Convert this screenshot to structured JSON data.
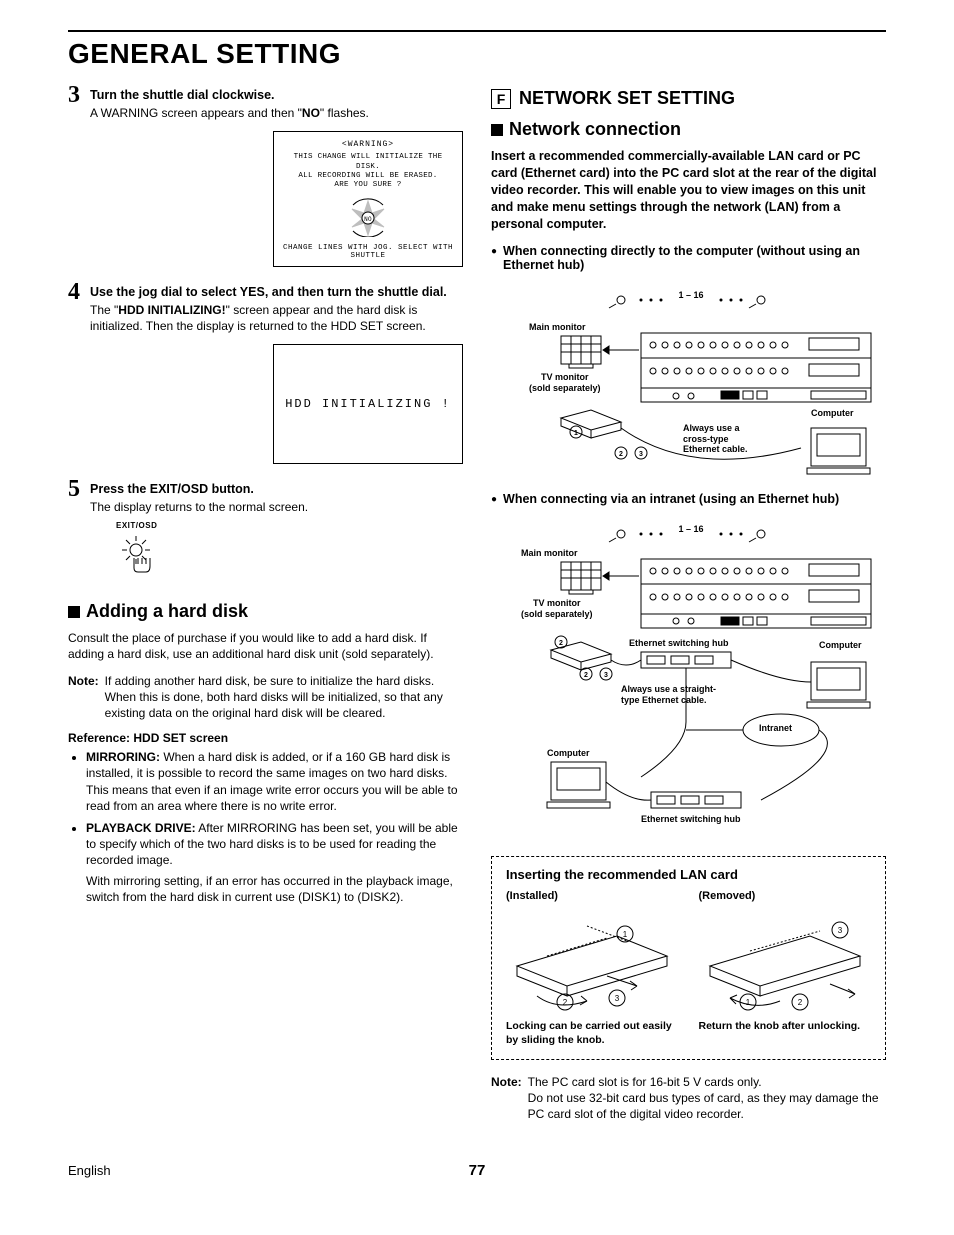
{
  "page_title": "GENERAL SETTING",
  "steps": {
    "s3": {
      "num": "3",
      "head": "Turn the shuttle dial clockwise.",
      "body_prefix": "A WARNING screen appears and then \"",
      "body_bold": "NO",
      "body_suffix": "\" flashes."
    },
    "warning_box": {
      "title": "<WARNING>",
      "line1": "THIS CHANGE WILL INITIALIZE THE DISK.",
      "line2": "ALL RECORDING WILL BE ERASED.",
      "line3": "ARE YOU SURE ?",
      "center": "NO",
      "footer": "CHANGE LINES WITH JOG. SELECT WITH SHUTTLE"
    },
    "s4": {
      "num": "4",
      "head": "Use the jog dial to select YES, and then turn the shuttle dial.",
      "body_prefix": "The \"",
      "body_bold": "HDD INITIALIZING!",
      "body_suffix": "\" screen appear and the hard disk is initialized. Then the display is returned to the HDD SET screen."
    },
    "init_box": "HDD INITIALIZING !",
    "s5": {
      "num": "5",
      "head": "Press the EXIT/OSD button.",
      "body": "The display returns to the normal screen.",
      "icon_label": "EXIT/OSD"
    }
  },
  "adding": {
    "title": "Adding a hard disk",
    "intro": "Consult the place of purchase if you would like to add a hard disk. If adding a hard disk, use an additional hard disk unit (sold separately).",
    "note_label": "Note:",
    "note_body": "If adding another hard disk, be sure to initialize the hard disks. When this is done, both hard disks will be initialized, so that any existing data on the original hard disk will be cleared.",
    "ref_title": "Reference: HDD SET screen",
    "mirroring_label": "MIRRORING:",
    "mirroring_body": "When a hard disk is added, or if a 160 GB hard disk is installed, it is possible to record the same images on two hard disks. This means that even if an image write error occurs you will be able to read from an area where there is no write error.",
    "playback_label": "PLAYBACK DRIVE:",
    "playback_body": "After MIRRORING has been set, you will be able to specify which of the two hard disks is to be used for reading the recorded image.",
    "playback_extra": "With mirroring setting, if an error has occurred in the playback image, switch from the hard disk in current use (DISK1) to (DISK2)."
  },
  "network": {
    "box_letter": "F",
    "section_title": "NETWORK SET SETTING",
    "sub_title": "Network connection",
    "intro": "Insert a recommended commercially-available LAN card or PC card (Ethernet card) into the PC card slot at the rear of the digital video recorder. This will enable you to view images on this unit and make menu settings through the network (LAN) from a personal computer.",
    "bullet1": "When connecting directly to the computer (without using an Ethernet hub)",
    "bullet2": "When connecting via an intranet (using an Ethernet hub)",
    "diag1": {
      "range": "1 – 16",
      "main_mon": "Main monitor",
      "tv_mon": "TV monitor\n(sold separately)",
      "computer": "Computer",
      "cable_note": "Always use a\ncross-type\nEthernet cable."
    },
    "diag2": {
      "range": "1 – 16",
      "main_mon": "Main monitor",
      "tv_mon": "TV monitor\n(sold separately)",
      "computer": "Computer",
      "computer2": "Computer",
      "hub1": "Ethernet switching hub",
      "hub2": "Ethernet switching hub",
      "cable_note": "Always use a straight-\ntype Ethernet cable.",
      "intranet": "Intranet"
    },
    "lan_box": {
      "title": "Inserting the recommended LAN card",
      "installed": "(Installed)",
      "removed": "(Removed)",
      "cap1": "Locking can be carried out easily by sliding the knob.",
      "cap2": "Return the knob after unlocking."
    },
    "note_label": "Note:",
    "note_body": "The PC card slot is for 16-bit 5 V cards only.\nDo not use 32-bit card bus types of card, as they may damage the PC card slot of the digital video recorder."
  },
  "footer": {
    "lang": "English",
    "page": "77"
  }
}
